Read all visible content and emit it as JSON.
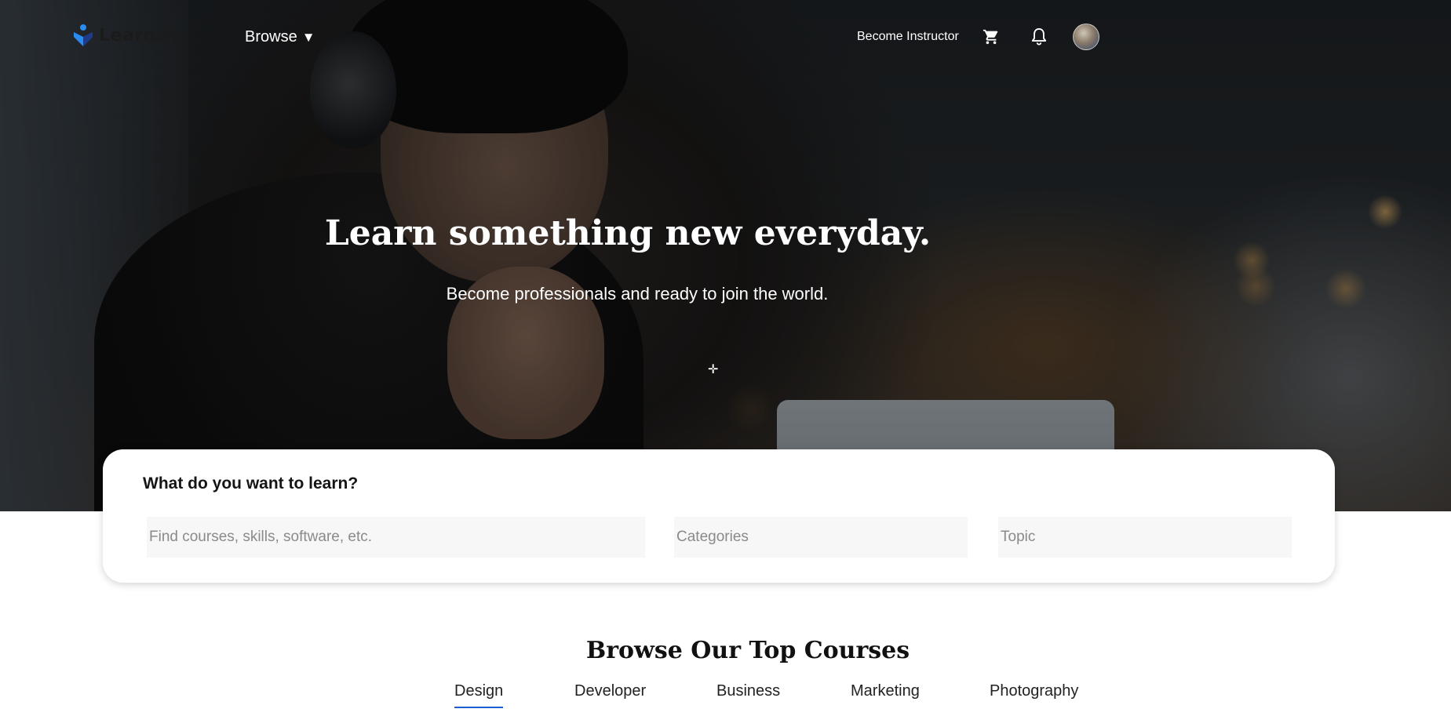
{
  "app": {
    "name": "Learnify"
  },
  "nav": {
    "browse_label": "Browse",
    "caret": "▼",
    "become_instructor": "Become Instructor",
    "cart_icon": "cart-icon",
    "bell_icon": "bell-icon"
  },
  "hero": {
    "title": "Learn something new everyday.",
    "subtitle": "Become professionals and ready to join the world."
  },
  "search": {
    "title": "What do you want to learn?",
    "query_placeholder": "Find courses, skills, software, etc.",
    "categories_placeholder": "Categories",
    "topic_placeholder": "Topic"
  },
  "courses": {
    "title": "Browse Our Top Courses",
    "tabs": [
      {
        "label": "Design",
        "active": true
      },
      {
        "label": "Developer",
        "active": false
      },
      {
        "label": "Business",
        "active": false
      },
      {
        "label": "Marketing",
        "active": false
      },
      {
        "label": "Photography",
        "active": false
      }
    ]
  },
  "colors": {
    "accent": "#1c5fd1",
    "logo_blue": "#2a8cf0",
    "logo_dark": "#1e3a8a"
  }
}
